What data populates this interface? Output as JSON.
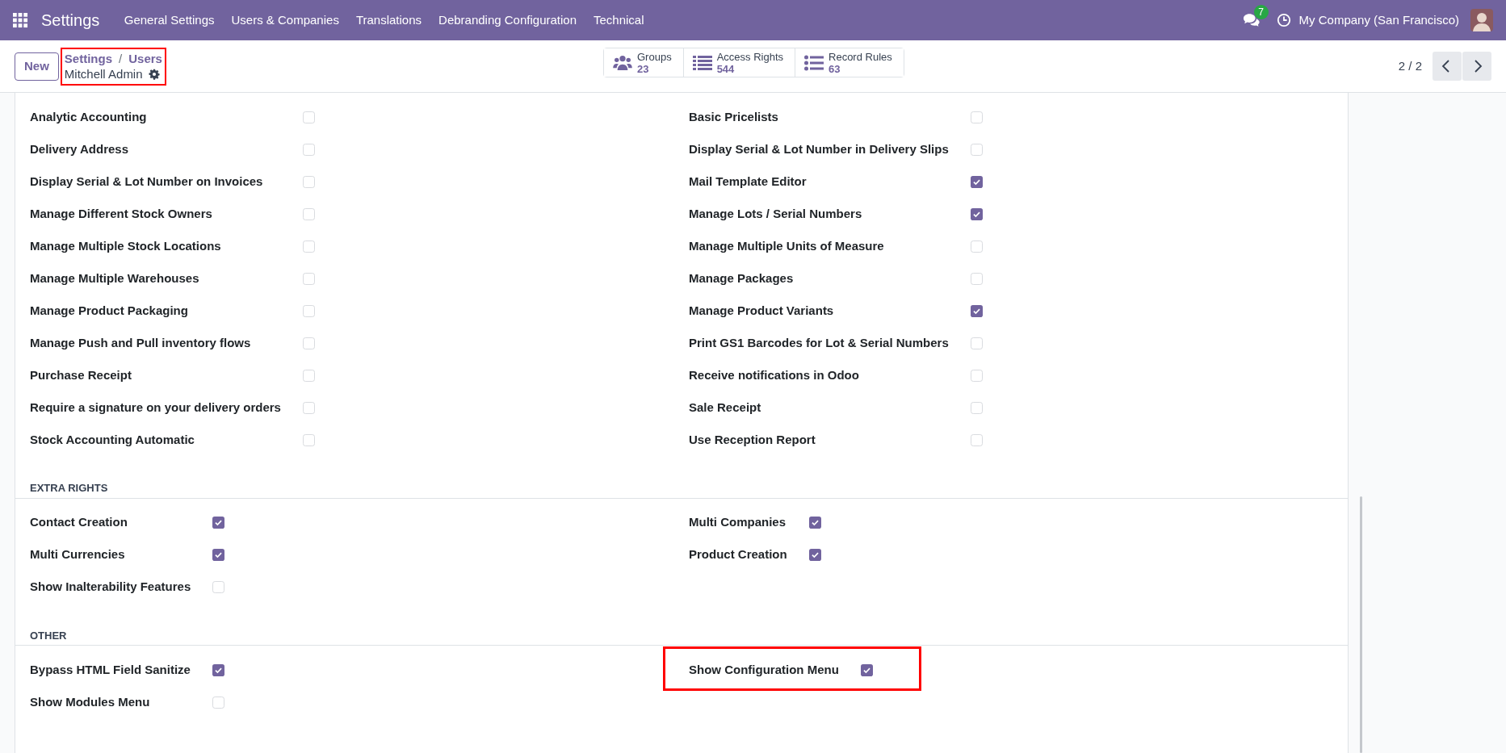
{
  "navbar": {
    "app_title": "Settings",
    "menu": [
      "General Settings",
      "Users & Companies",
      "Translations",
      "Debranding Configuration",
      "Technical"
    ],
    "messages_badge": "7",
    "company": "My Company (San Francisco)"
  },
  "control_panel": {
    "new_button": "New",
    "breadcrumb": [
      "Settings",
      "Users"
    ],
    "breadcrumb_separator": "/",
    "record_title": "Mitchell Admin",
    "highlighted": true,
    "smart_buttons": [
      {
        "kind": "groups",
        "label": "Groups",
        "count": "23"
      },
      {
        "kind": "list",
        "label": "Access Rights",
        "count": "544"
      },
      {
        "kind": "bullets",
        "label": "Record Rules",
        "count": "63"
      }
    ],
    "pager": "2 / 2"
  },
  "sections": [
    {
      "left": [
        {
          "label": "Analytic Accounting",
          "checked": false,
          "highlighted": false
        },
        {
          "label": "Delivery Address",
          "checked": false,
          "highlighted": false
        },
        {
          "label": "Display Serial & Lot Number on Invoices",
          "checked": false,
          "highlighted": false
        },
        {
          "label": "Manage Different Stock Owners",
          "checked": false,
          "highlighted": false
        },
        {
          "label": "Manage Multiple Stock Locations",
          "checked": false,
          "highlighted": false
        },
        {
          "label": "Manage Multiple Warehouses",
          "checked": false,
          "highlighted": false
        },
        {
          "label": "Manage Product Packaging",
          "checked": false,
          "highlighted": false
        },
        {
          "label": "Manage Push and Pull inventory flows",
          "checked": false,
          "highlighted": false
        },
        {
          "label": "Purchase Receipt",
          "checked": false,
          "highlighted": false
        },
        {
          "label": "Require a signature on your delivery orders",
          "checked": false,
          "highlighted": false
        },
        {
          "label": "Stock Accounting Automatic",
          "checked": false,
          "highlighted": false
        }
      ],
      "right": [
        {
          "label": "Basic Pricelists",
          "checked": false,
          "highlighted": false
        },
        {
          "label": "Display Serial & Lot Number in Delivery Slips",
          "checked": false,
          "highlighted": false
        },
        {
          "label": "Mail Template Editor",
          "checked": true,
          "highlighted": false
        },
        {
          "label": "Manage Lots / Serial Numbers",
          "checked": true,
          "highlighted": false
        },
        {
          "label": "Manage Multiple Units of Measure",
          "checked": false,
          "highlighted": false
        },
        {
          "label": "Manage Packages",
          "checked": false,
          "highlighted": false
        },
        {
          "label": "Manage Product Variants",
          "checked": true,
          "highlighted": false
        },
        {
          "label": "Print GS1 Barcodes for Lot & Serial Numbers",
          "checked": false,
          "highlighted": false
        },
        {
          "label": "Receive notifications in Odoo",
          "checked": false,
          "highlighted": false
        },
        {
          "label": "Sale Receipt",
          "checked": false,
          "highlighted": false
        },
        {
          "label": "Use Reception Report",
          "checked": false,
          "highlighted": false
        }
      ]
    },
    {
      "title": "EXTRA RIGHTS",
      "left": [
        {
          "label": "Contact Creation",
          "checked": true,
          "highlighted": false
        },
        {
          "label": "Multi Currencies",
          "checked": true,
          "highlighted": false
        },
        {
          "label": "Show Inalterability Features",
          "checked": false,
          "highlighted": false
        }
      ],
      "right": [
        {
          "label": "Multi Companies",
          "checked": true,
          "highlighted": false
        },
        {
          "label": "Product Creation",
          "checked": true,
          "highlighted": false
        }
      ]
    },
    {
      "title": "OTHER",
      "left": [
        {
          "label": "Bypass HTML Field Sanitize",
          "checked": true,
          "highlighted": false
        },
        {
          "label": "Show Modules Menu",
          "checked": false,
          "highlighted": false
        }
      ],
      "right": [
        {
          "label": "Show Configuration Menu",
          "checked": true,
          "highlighted": true
        }
      ]
    }
  ]
}
